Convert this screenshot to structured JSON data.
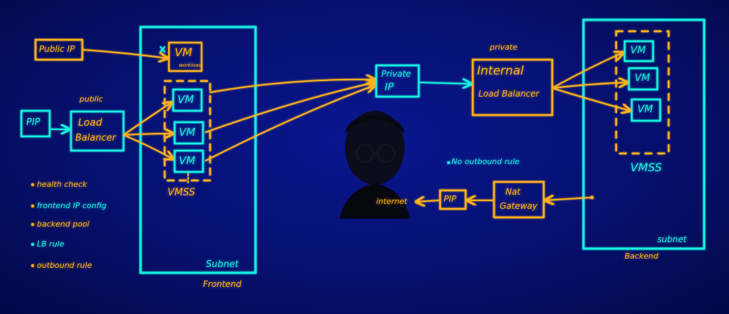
{
  "colors": {
    "board": "#050a6e",
    "yellow": "#ffb31a",
    "cyan": "#19f0e0",
    "white": "#ffffff"
  },
  "left": {
    "public_ip": "Public IP",
    "pip": "PIP",
    "lb_caption": "public",
    "lb_line1": "Load",
    "lb_line2": "Balancer",
    "notes": [
      "health check",
      "frontend IP config",
      "backend pool",
      "LB rule",
      "outbound rule"
    ]
  },
  "frontend": {
    "vm_single": "VM",
    "vm_single_sub": "workload",
    "x_mark": "x",
    "vmss_vms": [
      "VM",
      "VM",
      "VM"
    ],
    "vmss_label": "VMSS",
    "subnet": "Subnet",
    "name": "Frontend"
  },
  "center": {
    "private_ip_line1": "Private",
    "private_ip_line2": "IP",
    "outbound_note": "No outbound rule",
    "internet": "internet",
    "pip": "PIP",
    "nat_line1": "Nat",
    "nat_line2": "Gateway"
  },
  "internal_lb": {
    "caption": "private",
    "line1": "Internal",
    "line2": "Load Balancer"
  },
  "backend": {
    "vmss_vms": [
      "VM",
      "VM",
      "VM"
    ],
    "vmss_label": "VMSS",
    "subnet": "subnet",
    "name": "Backend"
  }
}
